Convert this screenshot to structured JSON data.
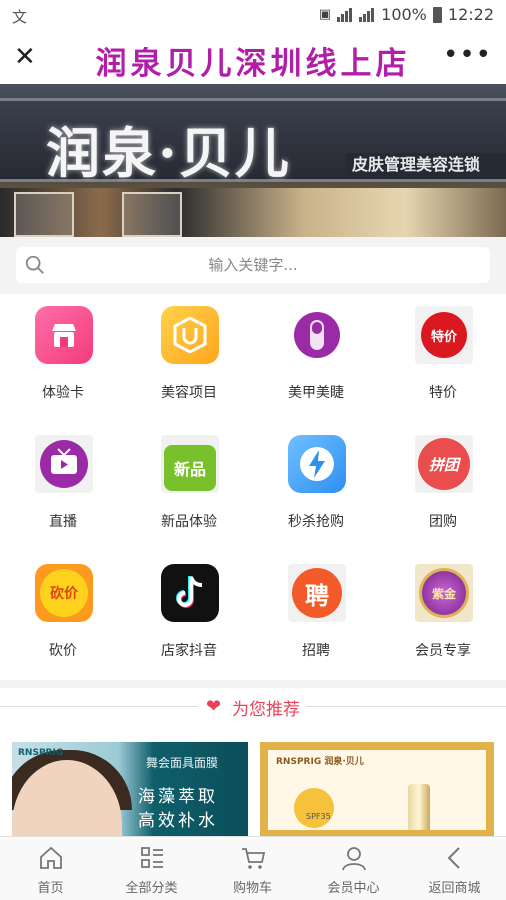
{
  "status": {
    "left_icon": "text-input-icon",
    "battery": "100%",
    "time": "12:22"
  },
  "titlebar": {
    "title": "润泉贝儿深圳线上店",
    "close_icon": "close-icon",
    "more_icon": "more-icon"
  },
  "banner": {
    "store_name": "润泉·贝儿",
    "slogan": "皮肤管理美容连锁"
  },
  "search": {
    "placeholder": "输入关键字..."
  },
  "categories": [
    {
      "label": "体验卡"
    },
    {
      "label": "美容项目"
    },
    {
      "label": "美甲美睫"
    },
    {
      "label": "特价",
      "icon_text": "特价"
    },
    {
      "label": "直播"
    },
    {
      "label": "新品体验",
      "icon_text": "新品"
    },
    {
      "label": "秒杀抢购"
    },
    {
      "label": "团购",
      "icon_text": "拼团"
    },
    {
      "label": "砍价",
      "icon_text": "砍价"
    },
    {
      "label": "店家抖音"
    },
    {
      "label": "招聘",
      "icon_text": "聘"
    },
    {
      "label": "会员专享",
      "icon_text": "紫金"
    }
  ],
  "recommend": {
    "title": "为您推荐",
    "products": [
      {
        "brand": "RNSPRIG",
        "line1": "舞会面具面膜",
        "line2": "海藻萃取",
        "line3": "高效补水"
      },
      {
        "brand": "RNSPRIG 润泉·贝儿",
        "badge": "SPF35"
      }
    ]
  },
  "tabs": [
    {
      "label": "首页",
      "icon": "home-icon"
    },
    {
      "label": "全部分类",
      "icon": "category-icon"
    },
    {
      "label": "购物车",
      "icon": "cart-icon"
    },
    {
      "label": "会员中心",
      "icon": "user-icon"
    },
    {
      "label": "返回商城",
      "icon": "back-icon"
    }
  ],
  "colors": {
    "title": "#b11fa8",
    "accent": "#e8435a"
  }
}
